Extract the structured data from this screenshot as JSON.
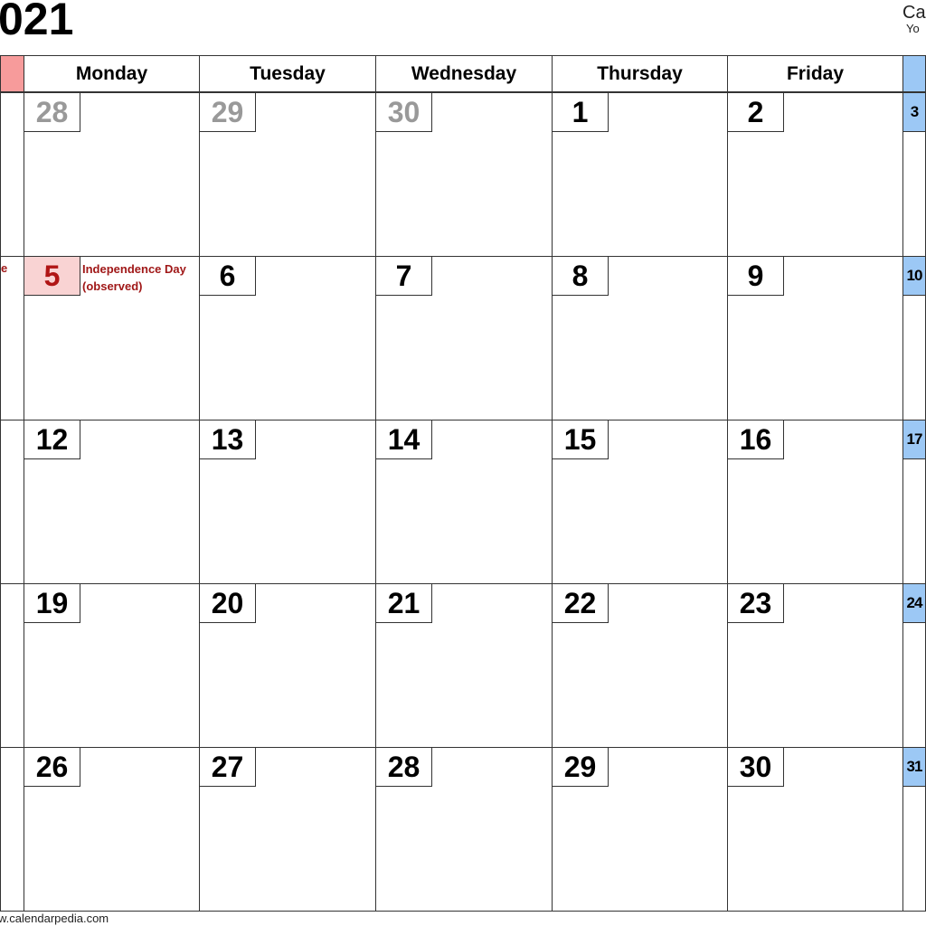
{
  "header": {
    "title": "021",
    "brand": "Ca",
    "brand_sub": "Yo"
  },
  "footer": "w.calendarpedia.com",
  "days": [
    "Monday",
    "Tuesday",
    "Wednesday",
    "Thursday",
    "Friday"
  ],
  "colors": {
    "sunday_header": "#f79b9b",
    "saturday": "#9cc8f5",
    "holiday": "#f9d3d3",
    "holiday_text": "#b01515"
  },
  "weeks": [
    {
      "sun_note": "",
      "days": [
        "28",
        "29",
        "30",
        "1",
        "2",
        "3"
      ],
      "muted": [
        true,
        true,
        true,
        false,
        false,
        false
      ]
    },
    {
      "sun_note": "e",
      "days": [
        "5",
        "6",
        "7",
        "8",
        "9",
        "10"
      ],
      "muted": [
        false,
        false,
        false,
        false,
        false,
        false
      ],
      "holiday": "Independence Day (observed)"
    },
    {
      "sun_note": "",
      "days": [
        "12",
        "13",
        "14",
        "15",
        "16",
        "17"
      ],
      "muted": [
        false,
        false,
        false,
        false,
        false,
        false
      ]
    },
    {
      "sun_note": "",
      "days": [
        "19",
        "20",
        "21",
        "22",
        "23",
        "24"
      ],
      "muted": [
        false,
        false,
        false,
        false,
        false,
        false
      ]
    },
    {
      "sun_note": "",
      "days": [
        "26",
        "27",
        "28",
        "29",
        "30",
        "31"
      ],
      "muted": [
        false,
        false,
        false,
        false,
        false,
        false
      ]
    }
  ]
}
